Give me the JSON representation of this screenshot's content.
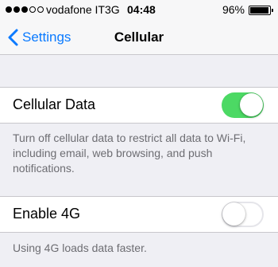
{
  "status_bar": {
    "signal_dots_filled": 3,
    "signal_dots_total": 5,
    "carrier": "vodafone IT",
    "network": "3G",
    "time": "04:48",
    "battery_percent": "96%",
    "battery_level": 0.96
  },
  "nav": {
    "back_label": "Settings",
    "title": "Cellular"
  },
  "cellular_data": {
    "label": "Cellular Data",
    "enabled": true,
    "footer": "Turn off cellular data to restrict all data to Wi-Fi, including email, web browsing, and push notifications."
  },
  "enable_4g": {
    "label": "Enable 4G",
    "enabled": false,
    "footer": "Using 4G loads data faster."
  },
  "colors": {
    "accent": "#0a7aff",
    "toggle_on": "#4cd964",
    "background": "#efeff4"
  }
}
